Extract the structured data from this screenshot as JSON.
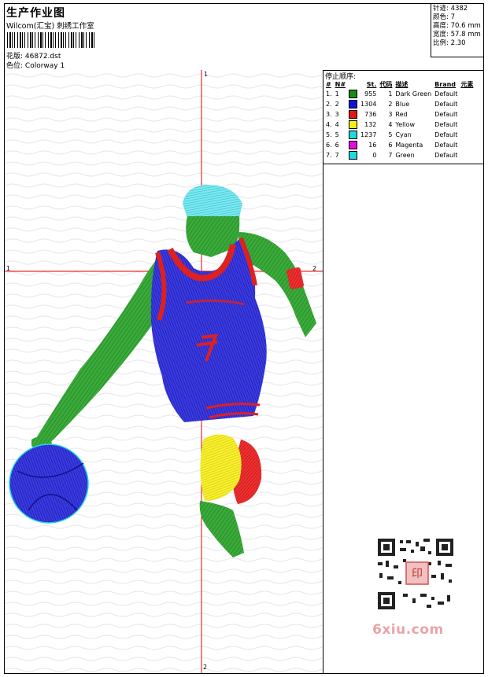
{
  "header": {
    "title": "生产作业图",
    "studio": "Wilcom(汇宝) 刺绣工作室",
    "design_label": "花版:",
    "design_value": "46872.dst",
    "colorway_label": "色位:",
    "colorway_value": "Colorway 1"
  },
  "stats": [
    {
      "label": "针迹:",
      "value": "4382"
    },
    {
      "label": "颜色:",
      "value": "7"
    },
    {
      "label": "高度:",
      "value": "70.6 mm"
    },
    {
      "label": "宽度:",
      "value": "57.8 mm"
    },
    {
      "label": "比例:",
      "value": "2.30"
    }
  ],
  "axis_marks": {
    "top": "1",
    "left": "1",
    "right": "2",
    "bottom": "2"
  },
  "stop_sequence": {
    "title": "停止顺序:",
    "headers": [
      "#",
      "N#",
      "",
      "St.",
      "代码",
      "描述",
      "Brand",
      "元素"
    ],
    "rows": [
      {
        "n": "1.",
        "needle": "1",
        "color": "#1a8a1a",
        "stitches": "955",
        "code": "1",
        "desc": "Dark Green",
        "brand": "Default"
      },
      {
        "n": "2.",
        "needle": "2",
        "color": "#1010d8",
        "stitches": "1304",
        "code": "2",
        "desc": "Blue",
        "brand": "Default"
      },
      {
        "n": "3.",
        "needle": "3",
        "color": "#e01818",
        "stitches": "736",
        "code": "3",
        "desc": "Red",
        "brand": "Default"
      },
      {
        "n": "4.",
        "needle": "4",
        "color": "#f5f018",
        "stitches": "132",
        "code": "4",
        "desc": "Yellow",
        "brand": "Default"
      },
      {
        "n": "5.",
        "needle": "5",
        "color": "#20d8e0",
        "stitches": "1237",
        "code": "5",
        "desc": "Cyan",
        "brand": "Default"
      },
      {
        "n": "6.",
        "needle": "6",
        "color": "#e010e0",
        "stitches": "16",
        "code": "6",
        "desc": "Magenta",
        "brand": "Default"
      },
      {
        "n": "7.",
        "needle": "7",
        "color": "#20d8e0",
        "stitches": "0",
        "code": "7",
        "desc": "Green",
        "brand": "Default"
      }
    ]
  },
  "watermark": {
    "brand": "6xiu.com",
    "seal": "印"
  },
  "colors": {
    "crosshair": "#e00000",
    "dark_green": "#2e9a2e",
    "blue": "#2222cc",
    "red": "#dd2020",
    "yellow": "#f4ee20",
    "cyan": "#30d0e0"
  }
}
